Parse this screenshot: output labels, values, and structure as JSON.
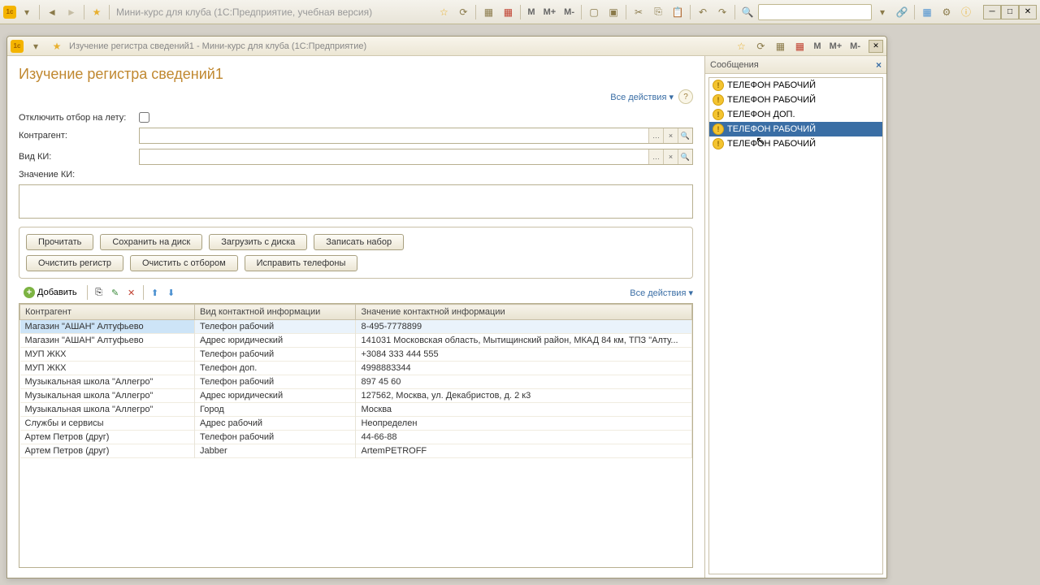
{
  "app_title": "Мини-курс для клуба  (1С:Предприятие, учебная версия)",
  "sub_window_title": "Изучение регистра сведений1 - Мини-курс для клуба  (1С:Предприятие)",
  "page_heading": "Изучение регистра сведений1",
  "all_actions_label": "Все действия ▾",
  "filters": {
    "disable_filter_label": "Отключить отбор на лету:",
    "contractor_label": "Контрагент:",
    "ci_type_label": "Вид КИ:",
    "ci_value_label": "Значение КИ:"
  },
  "buttons": {
    "read": "Прочитать",
    "save_disk": "Сохранить на диск",
    "load_disk": "Загрузить с диска",
    "write_set": "Записать набор",
    "clear_register": "Очистить регистр",
    "clear_with_filter": "Очистить с отбором",
    "fix_phones": "Исправить телефоны",
    "add": "Добавить"
  },
  "grid": {
    "columns": [
      "Контрагент",
      "Вид контактной информации",
      "Значение контактной информации"
    ],
    "rows": [
      {
        "c0": "Магазин \"АШАН\" Алтуфьево",
        "c1": "Телефон рабочий",
        "c2": "8-495-7778899",
        "sel": true
      },
      {
        "c0": "Магазин \"АШАН\" Алтуфьево",
        "c1": "Адрес юридический",
        "c2": "141031 Московская область, Мытищинский район, МКАД 84 км, ТПЗ \"Алту..."
      },
      {
        "c0": "МУП ЖКХ",
        "c1": "Телефон рабочий",
        "c2": "+3084 333 444 555"
      },
      {
        "c0": "МУП ЖКХ",
        "c1": "Телефон доп.",
        "c2": "4998883344"
      },
      {
        "c0": "Музыкальная школа \"Аллегро\"",
        "c1": "Телефон рабочий",
        "c2": "897 45 60"
      },
      {
        "c0": "Музыкальная школа \"Аллегро\"",
        "c1": "Адрес юридический",
        "c2": "127562, Москва, ул. Декабристов, д. 2 к3"
      },
      {
        "c0": "Музыкальная школа \"Аллегро\"",
        "c1": "Город",
        "c2": "Москва"
      },
      {
        "c0": "Службы и сервисы",
        "c1": "Адрес рабочий",
        "c2": "Неопределен"
      },
      {
        "c0": "Артем Петров (друг)",
        "c1": "Телефон рабочий",
        "c2": "44-66-88"
      },
      {
        "c0": "Артем Петров (друг)",
        "c1": "Jabber",
        "c2": "ArtemPETROFF"
      }
    ]
  },
  "messages": {
    "title": "Сообщения",
    "items": [
      {
        "text": "ТЕЛЕФОН РАБОЧИЙ"
      },
      {
        "text": "ТЕЛЕФОН РАБОЧИЙ"
      },
      {
        "text": "ТЕЛЕФОН ДОП."
      },
      {
        "text": "ТЕЛЕФОН РАБОЧИЙ",
        "sel": true
      },
      {
        "text": "ТЕЛЕФОН РАБОЧИЙ"
      }
    ]
  },
  "m_labels": {
    "m": "M",
    "mp": "M+",
    "mm": "M-"
  }
}
